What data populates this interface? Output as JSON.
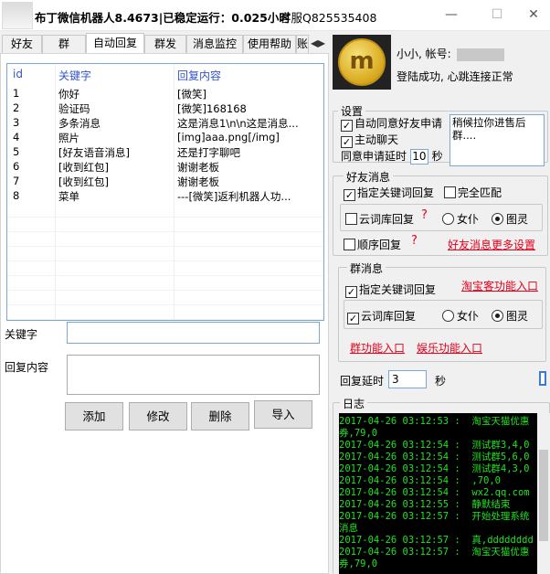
{
  "window": {
    "title": "布丁微信机器人8.4673|已稳定运行：0.025小时",
    "service": "客服Q825535408",
    "minimize": "—",
    "maximize": "☐",
    "close": "✕"
  },
  "tabs": [
    {
      "label": "好友"
    },
    {
      "label": "群"
    },
    {
      "label": "自动回复"
    },
    {
      "label": "群发"
    },
    {
      "label": "消息监控"
    },
    {
      "label": "使用帮助"
    },
    {
      "label": "账"
    }
  ],
  "table": {
    "headers": [
      "id",
      "关键字",
      "回复内容"
    ],
    "rows": [
      [
        "1",
        "你好",
        "[微笑]"
      ],
      [
        "2",
        "验证码",
        "[微笑]168168"
      ],
      [
        "3",
        "多条消息",
        "这是消息1\\n\\n这是消息..."
      ],
      [
        "4",
        "照片",
        "[img]aaa.png[/img]"
      ],
      [
        "5",
        "[好友语音消息]",
        "还是打字聊吧"
      ],
      [
        "6",
        "[收到红包]",
        "谢谢老板"
      ],
      [
        "7",
        "[收到红包]",
        "谢谢老板"
      ],
      [
        "8",
        "菜单",
        "---[微笑]返利机器人功..."
      ]
    ]
  },
  "form": {
    "keyword_label": "关键字",
    "keyword_value": "",
    "reply_label": "回复内容",
    "reply_value": ""
  },
  "buttons": {
    "add": "添加",
    "edit": "修改",
    "delete": "删除",
    "import": "导入"
  },
  "account": {
    "name_label": "小小, 帐号:",
    "status": "登陆成功, 心跳连接正常"
  },
  "settings": {
    "title": "设置",
    "auto_accept": "自动同意好友申请",
    "auto_chat": "主动聊天",
    "delay_label": "同意申请延时",
    "delay_value": "10",
    "delay_unit": "秒",
    "greeting_text": "稍候拉你进售后群...."
  },
  "friend_msg": {
    "title": "好友消息",
    "keyword_reply": "指定关键词回复",
    "exact_match": "完全匹配",
    "cloud_reply": "云词库回复",
    "female": "女仆",
    "tuling": "图灵",
    "order_reply": "顺序回复",
    "more_settings": "好友消息更多设置",
    "qmark": "?"
  },
  "group_msg": {
    "title": "群消息",
    "keyword_reply": "指定关键词回复",
    "taobao_link": "淘宝客功能入口",
    "cloud_reply": "云词库回复",
    "female": "女仆",
    "tuling": "图灵",
    "group_func": "群功能入口",
    "fun_func": "娱乐功能入口"
  },
  "reply_delay": {
    "label": "回复延时",
    "value": "3",
    "unit": "秒"
  },
  "log": {
    "title": "日志",
    "lines": [
      "2017-04-26 03:12:53 :  淘宝天猫优惠券,79,0",
      "2017-04-26 03:12:54 :  测试群3,4,0",
      "2017-04-26 03:12:54 :  测试群5,6,0",
      "2017-04-26 03:12:54 :  测试群4,3,0",
      "2017-04-26 03:12:54 :  ,70,0",
      "2017-04-26 03:12:54 :  wx2.qq.com",
      "2017-04-26 03:12:55 :  静默结束",
      "2017-04-26 03:12:57 :  开始处理系统消息",
      "2017-04-26 03:12:57 :  真,dddddddd",
      "2017-04-26 03:12:57 :  淘宝天猫优惠券,79,0"
    ]
  },
  "colors": {
    "link_red": "#e3001b",
    "log_bg": "#000000",
    "log_text": "#22e022",
    "header_blue": "#3355cc"
  }
}
